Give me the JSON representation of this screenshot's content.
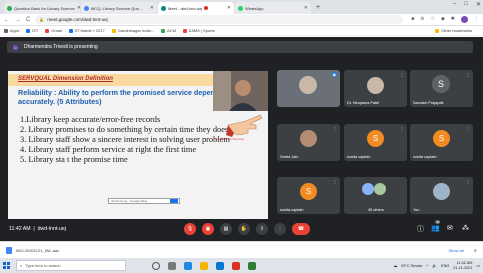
{
  "browser": {
    "tabs": [
      {
        "label": "Question Bank for Library Science",
        "color": "#34a853",
        "active": false
      },
      {
        "label": "MCQ: Library Science Que...",
        "color": "#4285f4",
        "active": false
      },
      {
        "label": "Meet - dwd-lnnt-uej",
        "color": "#00897b",
        "active": true
      },
      {
        "label": "WhatsApp",
        "color": "#25d366",
        "active": false
      }
    ],
    "new_tab": "+",
    "window_controls": [
      "–",
      "□",
      "✕"
    ],
    "back": "←",
    "forward": "→",
    "reload": "C",
    "url": "meet.google.com/dwd-lnnt-uej",
    "bookmarks": [
      {
        "label": "Apps",
        "color": "#5f6368"
      },
      {
        "label": "IST",
        "color": "#1a73e8"
      },
      {
        "label": "Gmail",
        "color": "#ea4335"
      },
      {
        "label": "IIT Mandi » 2017",
        "color": "#1a73e8"
      },
      {
        "label": "Gandhinagar India...",
        "color": "#fbbc04"
      },
      {
        "label": "ACM",
        "color": "#34a853"
      },
      {
        "label": "AIIMS | Sports",
        "color": "#ea4335"
      }
    ],
    "other_bookmarks": "Other bookmarks"
  },
  "meet": {
    "presenter_initial": "D",
    "presenting_text": "Dharmendra Trivedi is presenting",
    "slide": {
      "title": "SERVQUAL Dimension Definition",
      "subtitle": "Reliability : Ability to perform the promised service dependably and accurately. (5 Attributes)",
      "items": [
        "1.Library keep accurate/error-free records",
        "2. Library promises to do something by certain time they does",
        "3. Library staff show a sincere interest in solving user problem",
        "4. Library staff perform service at right the first time",
        "5. Library sta              t the promise time"
      ],
      "note": "Do it right the first time",
      "caption_chip": "dwd-lnnt-uej - Google Meet"
    },
    "tiles": [
      {
        "name": "Dr. Nirupama Patel",
        "kind": "photo",
        "color": "#c9b8a8"
      },
      {
        "name": "Saurabh Prajapati",
        "kind": "letter",
        "letter": "S",
        "color": "#5f6368"
      },
      {
        "name": "Geeta Jain",
        "kind": "photo",
        "color": "#b48c74"
      },
      {
        "name": "sunita captain",
        "kind": "letter",
        "letter": "S",
        "color": "#f28b22"
      },
      {
        "name": "sunita captain",
        "kind": "letter",
        "letter": "S",
        "color": "#f28b22"
      },
      {
        "name": "sunita captain",
        "kind": "letter",
        "letter": "S",
        "color": "#f28b22"
      },
      {
        "name": "45 others",
        "kind": "group",
        "color": "#8ab4f8"
      },
      {
        "name": "You",
        "kind": "photo",
        "color": "#9fb3c8"
      }
    ],
    "time": "11:42 AM",
    "meeting_code": "dwd-lnnt-uej",
    "participants_badge": "48"
  },
  "download": {
    "filename": "IMG-20201121_IWL.aac",
    "show_all": "Show all",
    "close": "✕"
  },
  "taskbar": {
    "search_placeholder": "Type here to search",
    "tray_text": "29°C Smoke",
    "lang": "ENG",
    "clock_time": "11:42 AM",
    "clock_date": "21-11-2021"
  }
}
